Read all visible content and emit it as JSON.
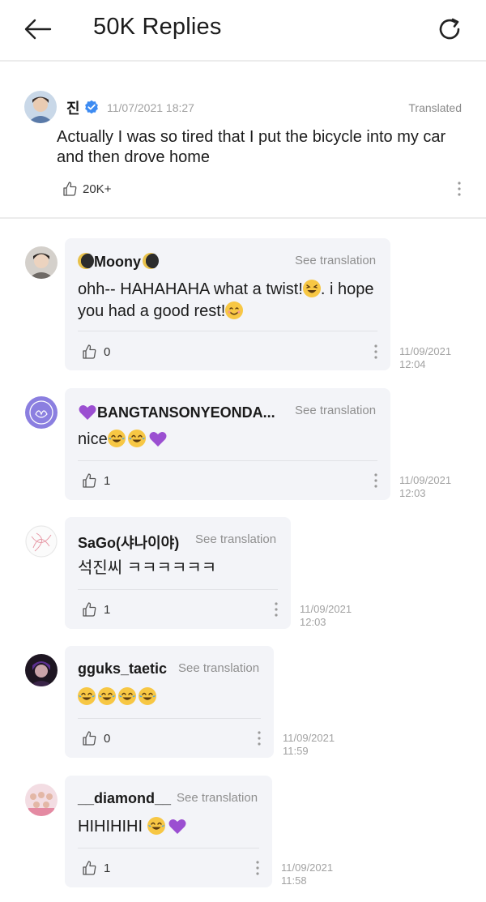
{
  "header": {
    "title": "50K Replies",
    "back_icon": "back-arrow-icon",
    "refresh_icon": "refresh-icon"
  },
  "post": {
    "author": "진",
    "verified_icon": "verified-badge-icon",
    "timestamp": "11/07/2021 18:27",
    "translated_label": "Translated",
    "text": "Actually I was so tired that I put the bicycle into my car and then drove home",
    "like_count": "20K+"
  },
  "replies": [
    {
      "name": "Moony",
      "see_translation": "See translation",
      "text": "ohh-- HAHAHAHA what a twist!",
      "text2": ". i hope you had a good rest!",
      "like_count": "0",
      "date": "11/09/2021",
      "time": "12:04"
    },
    {
      "name": "BANGTANSONYEONDA...",
      "see_translation": "See translation",
      "text": "nice",
      "like_count": "1",
      "date": "11/09/2021",
      "time": "12:03"
    },
    {
      "name": "SaGo(샤나이야)",
      "see_translation": "See translation",
      "text": "석진씨 ㅋㅋㅋㅋㅋㅋ",
      "like_count": "1",
      "date": "11/09/2021",
      "time": "12:03"
    },
    {
      "name": "gguks_taetic",
      "see_translation": "See translation",
      "text": "",
      "like_count": "0",
      "date": "11/09/2021",
      "time": "11:59"
    },
    {
      "name": "__diamond__",
      "see_translation": "See translation",
      "text": "HIHIHIHI ",
      "like_count": "1",
      "date": "11/09/2021",
      "time": "11:58"
    }
  ],
  "colors": {
    "verified": "#3d8bf2",
    "bubble": "#f3f4f8",
    "heart": "#9b4fd1",
    "emoji": "#f7c744"
  }
}
